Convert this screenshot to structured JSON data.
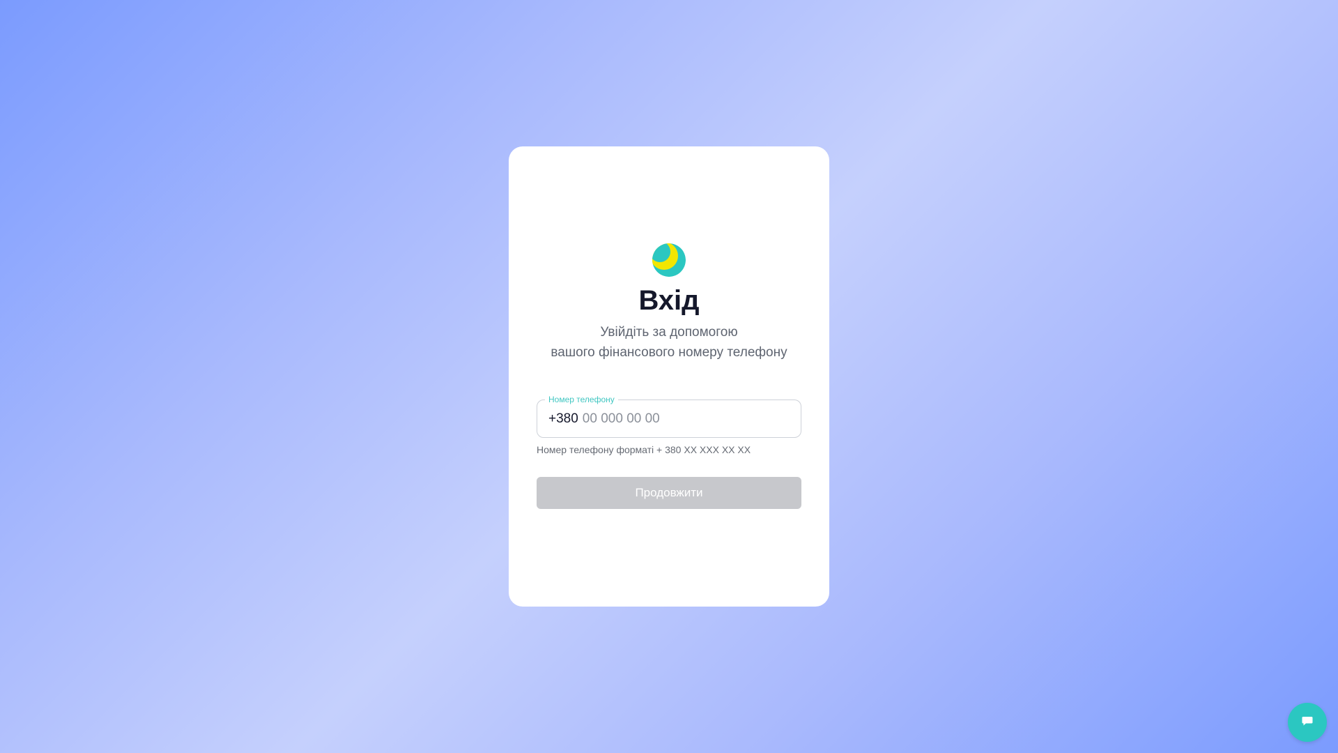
{
  "login": {
    "title": "Вхід",
    "subtitle_line1": "Увійдіть за допомогою",
    "subtitle_line2": "вашого фінансового номеру телефону",
    "phone_field": {
      "label": "Номер телефону",
      "prefix": "+380",
      "placeholder": "00 000 00 00",
      "value": ""
    },
    "hint": "Номер телефону форматі + 380 XX XXX XX XX",
    "continue_label": "Продовжити"
  },
  "icons": {
    "logo": "logo-icon",
    "chat": "chat-icon"
  },
  "colors": {
    "accent": "#2bc7c1",
    "logo_yellow": "#f2e600",
    "title": "#15182b",
    "button_disabled": "#c7c8cc"
  }
}
